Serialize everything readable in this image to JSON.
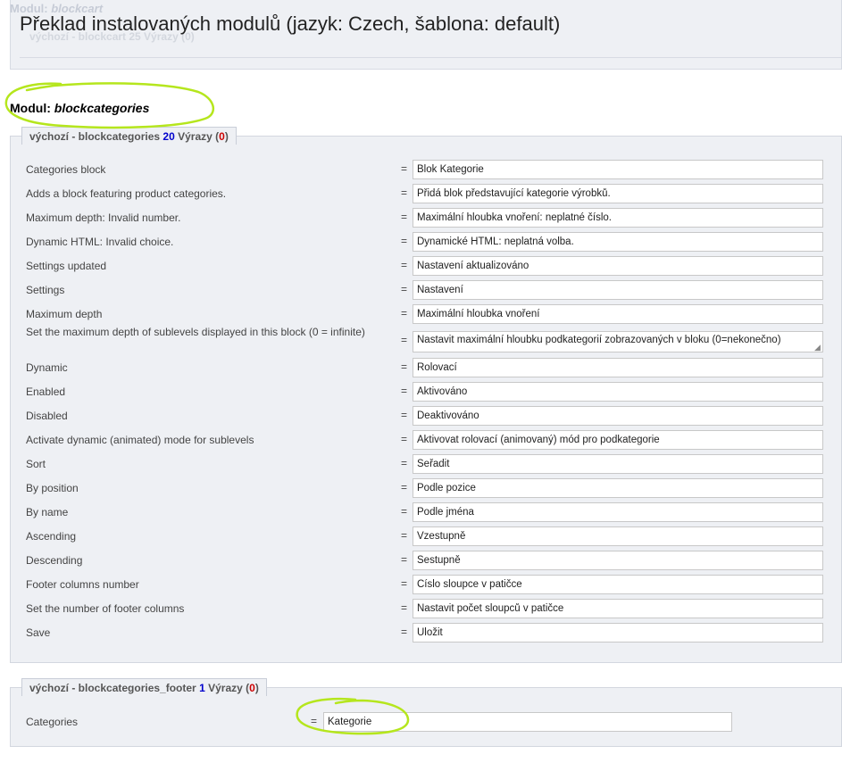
{
  "page": {
    "title": "Překlad instalovaných modulů (jazyk: Czech, šablona: default)"
  },
  "ghost": {
    "module_prefix": "Modul: ",
    "module_name": "blockcart",
    "legend": "výchozí - blockcart 25 Výrazy (0)"
  },
  "module": {
    "prefix": "Modul: ",
    "name": "blockcategories"
  },
  "sections": [
    {
      "legend_prefix": "výchozí - blockcategories",
      "count": "20",
      "label_word": "Výrazy",
      "missing": "0",
      "rows": [
        {
          "source": "Categories block",
          "translation": "Blok Kategorie"
        },
        {
          "source": "Adds a block featuring product categories.",
          "translation": "Přidá blok představující kategorie výrobků."
        },
        {
          "source": "Maximum depth: Invalid number.",
          "translation": "Maximální hloubka vnoření: neplatné číslo."
        },
        {
          "source": "Dynamic HTML: Invalid choice.",
          "translation": "Dynamické HTML: neplatná volba."
        },
        {
          "source": "Settings updated",
          "translation": "Nastavení aktualizováno"
        },
        {
          "source": "Settings",
          "translation": "Nastavení"
        },
        {
          "source": "Maximum depth",
          "translation": "Maximální hloubka vnoření"
        },
        {
          "source": "Set the maximum depth of sublevels displayed in this block (0 = infinite)",
          "translation": "Nastavit maximální hloubku podkategorií zobrazovaných v bloku (0=nekonečno)"
        },
        {
          "source": "Dynamic",
          "translation": "Rolovací"
        },
        {
          "source": "Enabled",
          "translation": "Aktivováno"
        },
        {
          "source": "Disabled",
          "translation": "Deaktivováno"
        },
        {
          "source": "Activate dynamic (animated) mode for sublevels",
          "translation": "Aktivovat rolovací (animovaný) mód pro podkategorie"
        },
        {
          "source": "Sort",
          "translation": "Seřadit"
        },
        {
          "source": "By position",
          "translation": "Podle pozice"
        },
        {
          "source": "By name",
          "translation": "Podle jména"
        },
        {
          "source": "Ascending",
          "translation": "Vzestupně"
        },
        {
          "source": "Descending",
          "translation": "Sestupně"
        },
        {
          "source": "Footer columns number",
          "translation": "Číslo sloupce v patičce"
        },
        {
          "source": "Set the number of footer columns",
          "translation": "Nastavit počet sloupců v patičce"
        },
        {
          "source": "Save",
          "translation": "Uložit"
        }
      ]
    },
    {
      "legend_prefix": "výchozí - blockcategories_footer",
      "count": "1",
      "label_word": "Výrazy",
      "missing": "0",
      "rows": [
        {
          "source": "Categories",
          "translation": "Kategorie"
        }
      ]
    }
  ],
  "equals_sign": "=",
  "colors": {
    "highlight_annotation": "#b5e61d",
    "count": "#0000cc",
    "missing": "#cc0000",
    "panel_bg": "#eef0f4"
  }
}
